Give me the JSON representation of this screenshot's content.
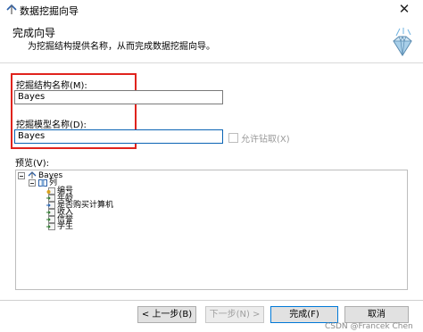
{
  "window": {
    "title": "数据挖掘向导",
    "close_glyph": "✕"
  },
  "header": {
    "title": "完成向导",
    "subtitle": "为挖掘结构提供名称，从而完成数据挖掘向导。"
  },
  "structure_name": {
    "label": "挖掘结构名称(M):",
    "value": "Bayes"
  },
  "model_name": {
    "label": "挖掘模型名称(D):",
    "value": "Bayes"
  },
  "allow_drillthrough": {
    "label": "允许钻取(X)",
    "checked": false
  },
  "preview": {
    "label": "预览(V):",
    "root": "Bayes",
    "columns_node": "列",
    "columns": [
      "编号",
      "年龄",
      "是否购买计算机",
      "收入",
      "信誉",
      "学生"
    ]
  },
  "buttons": {
    "back": "< 上一步(B)",
    "next": "下一步(N) >",
    "finish": "完成(F)",
    "cancel": "取消"
  },
  "watermark": "CSDN @Francek Chen",
  "colors": {
    "highlight_box": "#e0231d",
    "focus_border": "#0a64b4",
    "default_button_border": "#0078d7"
  }
}
